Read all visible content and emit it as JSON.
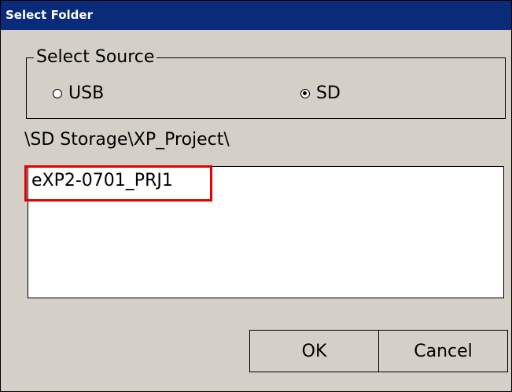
{
  "window": {
    "title": "Select Folder"
  },
  "source_group": {
    "legend": "Select Source",
    "options": [
      {
        "label": "USB",
        "checked": false
      },
      {
        "label": "SD",
        "checked": true
      }
    ]
  },
  "current_path": "\\SD Storage\\XP_Project\\",
  "folder_list": {
    "items": [
      "eXP2-0701_PRJ1"
    ],
    "highlight_color": "#e00000"
  },
  "buttons": {
    "ok": "OK",
    "cancel": "Cancel"
  },
  "colors": {
    "titlebar": "#0a2a7a",
    "dialog_bg": "#d4d0c8"
  }
}
